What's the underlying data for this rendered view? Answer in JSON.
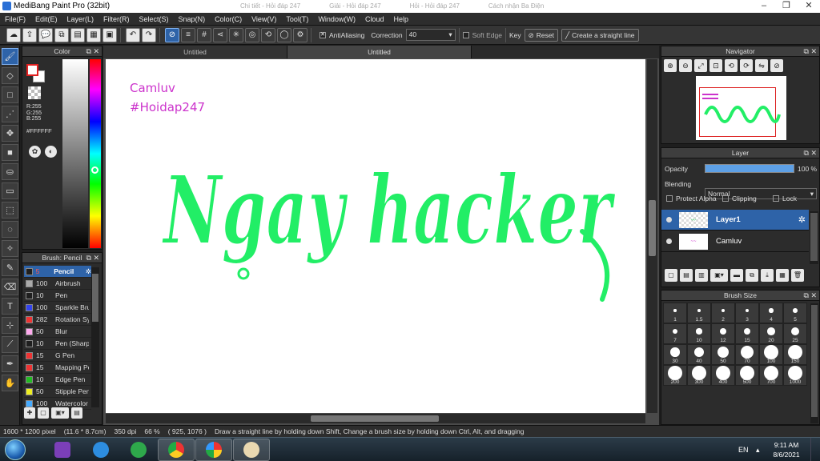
{
  "window": {
    "title": "MediBang Paint Pro (32bit)",
    "tab_titles": [
      "Chi tiết - Hỏi đáp 247",
      "Giải - Hỏi đáp 247",
      "Hỏi - Hỏi đáp 247",
      "Cách nhận Ba Điện"
    ]
  },
  "menu": [
    "File(F)",
    "Edit(E)",
    "Layer(L)",
    "Filter(R)",
    "Select(S)",
    "Snap(N)",
    "Color(C)",
    "View(V)",
    "Tool(T)",
    "Window(W)",
    "Cloud",
    "Help"
  ],
  "toolbar": {
    "antialiasing_label": "AntiAliasing",
    "correction_label": "Correction",
    "correction_value": "40",
    "soft_edge_label": "Soft Edge",
    "key_label": "Key",
    "reset_label": "Reset",
    "straight_line_label": "Create a straight line"
  },
  "color_panel": {
    "title": "Color",
    "rgb": [
      "R:255",
      "G:255",
      "B:255"
    ],
    "hex": "#FFFFFF"
  },
  "brush_panel": {
    "title": "Brush: Pencil",
    "brushes": [
      {
        "size": "5",
        "name": "Pencil",
        "color": "#1f1f1f"
      },
      {
        "size": "100",
        "name": "Airbrush",
        "color": "#aaaaaa"
      },
      {
        "size": "10",
        "name": "Pen",
        "color": "#1f1f1f"
      },
      {
        "size": "100",
        "name": "Sparkle Brush",
        "color": "#3344ee"
      },
      {
        "size": "282",
        "name": "Rotation Sym",
        "color": "#ee3333"
      },
      {
        "size": "50",
        "name": "Blur",
        "color": "#ffaaee"
      },
      {
        "size": "10",
        "name": "Pen (Sharp)",
        "color": "#1f1f1f"
      },
      {
        "size": "15",
        "name": "G Pen",
        "color": "#ee3333"
      },
      {
        "size": "15",
        "name": "Mapping Pen",
        "color": "#ee3333"
      },
      {
        "size": "10",
        "name": "Edge Pen",
        "color": "#22bb22"
      },
      {
        "size": "50",
        "name": "Stipple Pen",
        "color": "#eeee22"
      },
      {
        "size": "100",
        "name": "Watercolor",
        "color": "#44aaff"
      }
    ]
  },
  "canvas": {
    "tabs": [
      "Untitled",
      "Untitled"
    ],
    "text_line1": "Camluv",
    "text_line2": "#Hoidap247",
    "lettering": "Ngay hacker"
  },
  "navigator": {
    "title": "Navigator"
  },
  "layer_panel": {
    "title": "Layer",
    "opacity_label": "Opacity",
    "opacity_value": "100 %",
    "opacity": 1.0,
    "blending_label": "Blending",
    "blending_value": "Normal",
    "protect_alpha": "Protect Alpha",
    "clipping": "Clipping",
    "lock": "Lock",
    "layers": [
      {
        "name": "Layer1",
        "selected": true
      },
      {
        "name": "Camluv",
        "selected": false
      }
    ]
  },
  "brush_size_panel": {
    "title": "Brush Size",
    "sizes": [
      "1",
      "1.5",
      "2",
      "3",
      "4",
      "5",
      "7",
      "10",
      "12",
      "15",
      "20",
      "25",
      "30",
      "40",
      "50",
      "70",
      "100",
      "150",
      "200",
      "300",
      "400",
      "500",
      "700",
      "1000"
    ]
  },
  "statusbar": {
    "size": "1600 * 1200 pixel",
    "cm": "(11.6 * 8.7cm)",
    "dpi": "350 dpi",
    "zoom": "66 %",
    "coords": "( 925, 1076 )",
    "hint": "Draw a straight line by holding down Shift, Change a brush size by holding down Ctrl, Alt, and dragging"
  },
  "taskbar": {
    "lang": "EN",
    "time": "9:11 AM",
    "date": "8/6/2021"
  },
  "colors": {
    "accent": "#2e63a8",
    "lettering": "#22ee66",
    "signature": "#cc33cc"
  }
}
